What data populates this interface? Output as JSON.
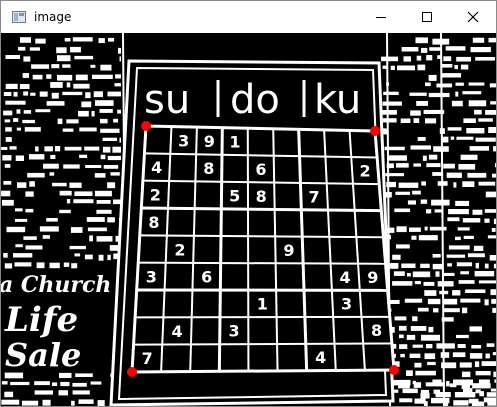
{
  "window": {
    "title": "image",
    "icons": {
      "app": "image-window-icon",
      "minimize": "minimize-icon",
      "maximize": "maximize-icon",
      "close": "close-icon"
    }
  },
  "image": {
    "heading": {
      "part1": "su",
      "part2": "do",
      "part3": "ku"
    },
    "newspaper_text": {
      "line1": "a Church",
      "line2": "Life",
      "line3": "Sale"
    },
    "grid": {
      "size": 9,
      "cells": [
        [
          "",
          "3",
          "9",
          "1",
          "",
          "",
          "",
          "",
          ""
        ],
        [
          "4",
          "",
          "8",
          "",
          "6",
          "",
          "",
          "",
          "2"
        ],
        [
          "2",
          "",
          "",
          "5",
          "8",
          "",
          "7",
          "",
          ""
        ],
        [
          "8",
          "",
          "",
          "",
          "",
          "",
          "",
          "",
          ""
        ],
        [
          "",
          "2",
          "",
          "",
          "",
          "9",
          "",
          "",
          ""
        ],
        [
          "3",
          "",
          "6",
          "",
          "",
          "",
          "",
          "4",
          "9"
        ],
        [
          "",
          "",
          "",
          "",
          "1",
          "",
          "",
          "3",
          ""
        ],
        [
          "",
          "4",
          "",
          "3",
          "",
          "",
          "",
          "",
          "8"
        ],
        [
          "7",
          "",
          "",
          "",
          "",
          "",
          "4",
          "",
          ""
        ]
      ]
    },
    "corner_marker_color": "#ff0000"
  }
}
